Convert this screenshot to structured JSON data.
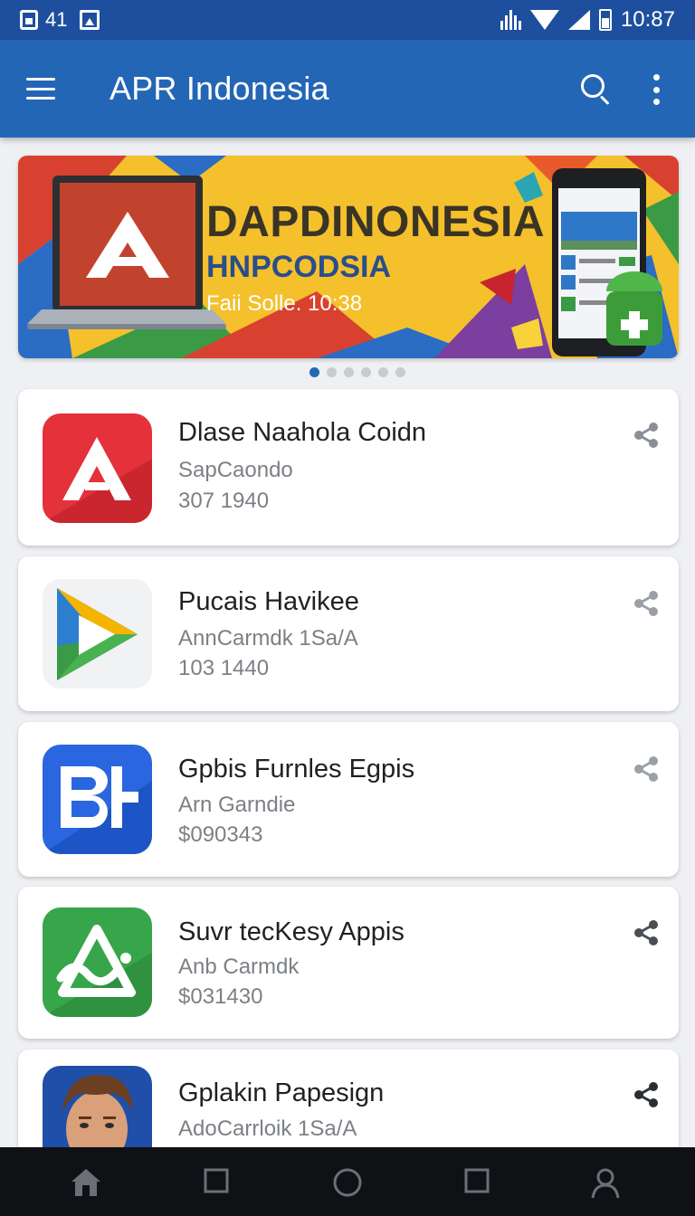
{
  "status_bar": {
    "notification_count": "41",
    "time": "10:87",
    "icons": [
      "notification-box-icon",
      "image-icon",
      "vibrate-icon",
      "wifi-icon",
      "cell-signal-icon",
      "battery-icon"
    ]
  },
  "app_bar": {
    "title": "APR Indonesia",
    "icons": [
      "menu-icon",
      "search-icon",
      "more-icon"
    ]
  },
  "banner": {
    "title": "DAPDINONESIA",
    "subtitle": "HNPCODSIA",
    "note": "Faii Solle. 10:38",
    "slide_count": 6,
    "active_slide": 1,
    "colors": {
      "background": "#f4c02c",
      "laptop_screen": "#c1432e",
      "accent_blue": "#2a4e8c"
    }
  },
  "apps": [
    {
      "name": "Dlase Naahola Coidn",
      "developer": "SapCaondo",
      "meta": "307 1940",
      "icon": "red-a-logo-icon"
    },
    {
      "name": "Pucais Havikee",
      "developer": "AnnCarmdk 1Sa/A",
      "meta": "103 1440",
      "icon": "play-store-logo-icon"
    },
    {
      "name": "Gpbis Furnles Egpis",
      "developer": "Arn Garndie",
      "meta": "$090343",
      "icon": "bh-logo-icon"
    },
    {
      "name": "Suvr tecKesy Appis",
      "developer": "Anb Carmdk",
      "meta": "$031430",
      "icon": "green-triangle-logo-icon"
    },
    {
      "name": "Gplakin Papesign",
      "developer": "AdoCarrloik 1Sa/A",
      "meta": "",
      "icon": "avatar-portrait-icon"
    }
  ],
  "nav_bar": {
    "items": [
      "home-icon",
      "square-icon",
      "circle-icon",
      "recents-icon",
      "profile-icon"
    ]
  },
  "colors": {
    "primary": "#2466b6",
    "status_bar": "#1d4f9e",
    "background": "#eef0f3",
    "nav_bar": "#0f1115"
  }
}
